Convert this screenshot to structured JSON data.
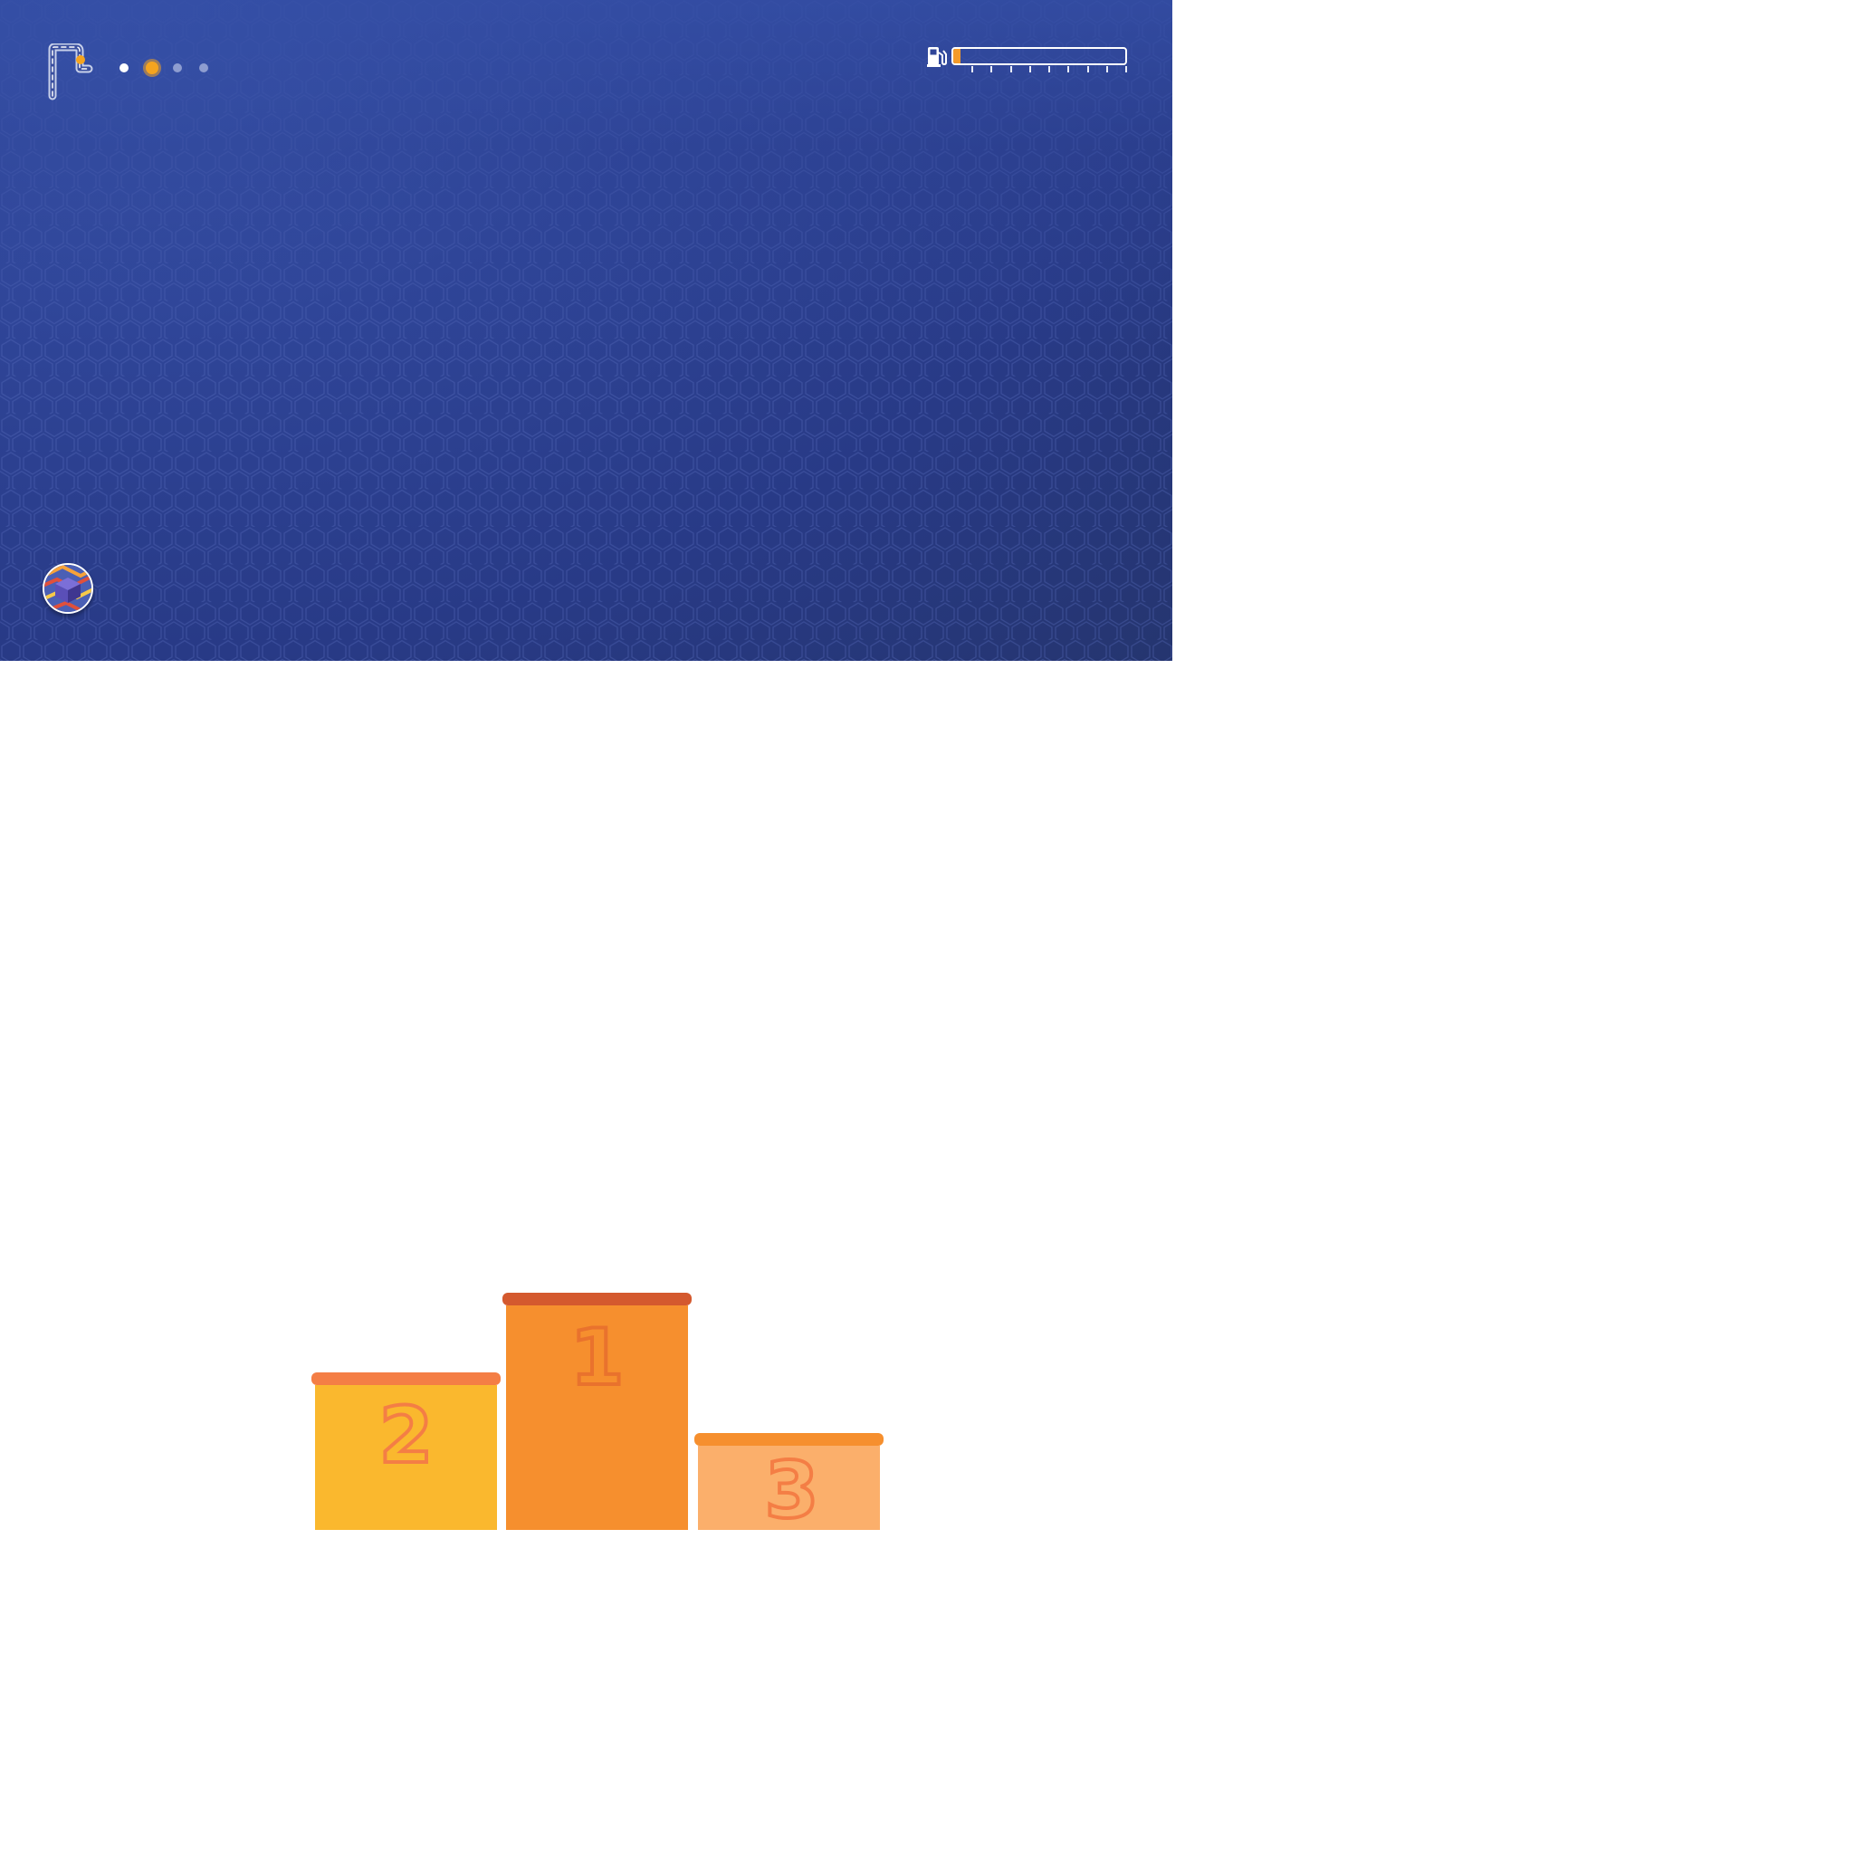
{
  "hud": {
    "route_icon": "route-path-icon",
    "level_progress": {
      "total": 4,
      "completed": 1,
      "current_index": 1
    },
    "fuel": {
      "icon": "fuel-pump-icon",
      "level": 0.04,
      "tick_count": 9
    },
    "avatar_icon": "warehouse-avatar-icon"
  },
  "podium": {
    "places": [
      {
        "rank": "2",
        "color": "#fab82e",
        "lid_color": "#f47e45",
        "num_color": "#f47e45"
      },
      {
        "rank": "1",
        "color": "#f68f2e",
        "lid_color": "#d4592e",
        "num_color": "#e9722d"
      },
      {
        "rank": "3",
        "color": "#fbaf6b",
        "lid_color": "#f68f2e",
        "num_color": "#f47e45"
      }
    ]
  },
  "colors": {
    "background_dark": "#25356f",
    "background_light": "#3a56ad",
    "accent": "#f5a41f"
  }
}
